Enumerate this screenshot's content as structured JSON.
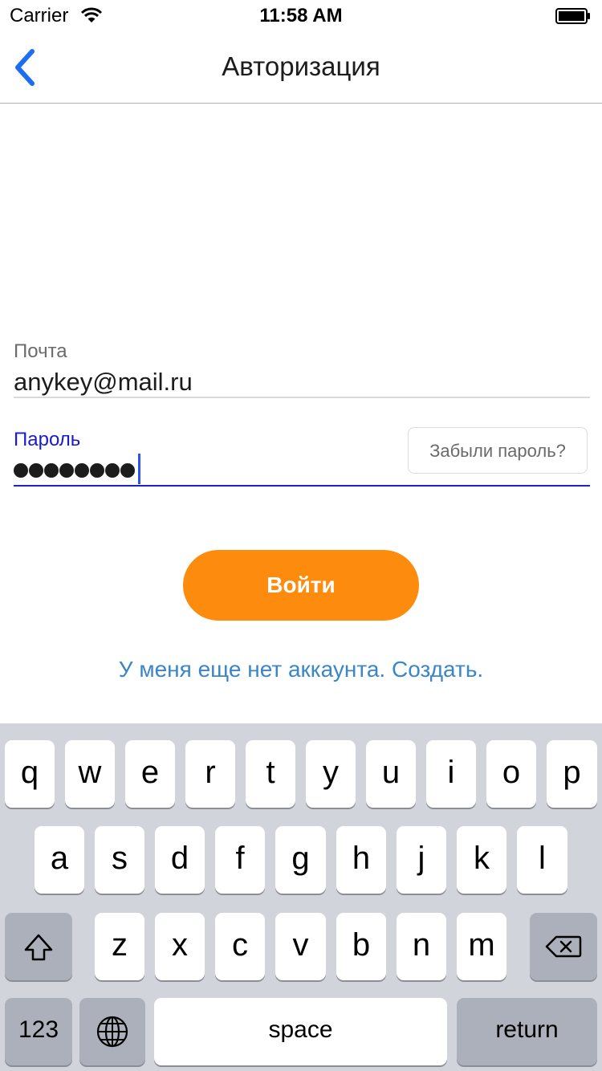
{
  "status_bar": {
    "carrier": "Carrier",
    "time": "11:58 AM"
  },
  "nav": {
    "title": "Авторизация",
    "back_icon": "chevron-left-icon"
  },
  "form": {
    "email_label": "Почта",
    "email_value": "anykey@mail.ru",
    "password_label": "Пароль",
    "password_masked_length": 8,
    "forgot_label": "Забыли пароль?",
    "login_label": "Войти",
    "signup_link": "У меня еще нет аккаунта. Создать."
  },
  "keyboard": {
    "row1": [
      "q",
      "w",
      "e",
      "r",
      "t",
      "y",
      "u",
      "i",
      "o",
      "p"
    ],
    "row2": [
      "a",
      "s",
      "d",
      "f",
      "g",
      "h",
      "j",
      "k",
      "l"
    ],
    "row3": [
      "z",
      "x",
      "c",
      "v",
      "b",
      "n",
      "m"
    ],
    "numbers_label": "123",
    "space_label": "space",
    "return_label": "return",
    "shift_icon": "shift-icon",
    "backspace_icon": "backspace-icon",
    "globe_icon": "globe-icon"
  },
  "colors": {
    "accent_orange": "#fd8c0e",
    "link_blue": "#3a86c9",
    "active_field": "#1a1ad4",
    "nav_back_blue": "#1b6ef3",
    "keyboard_bg": "#d1d4db"
  }
}
